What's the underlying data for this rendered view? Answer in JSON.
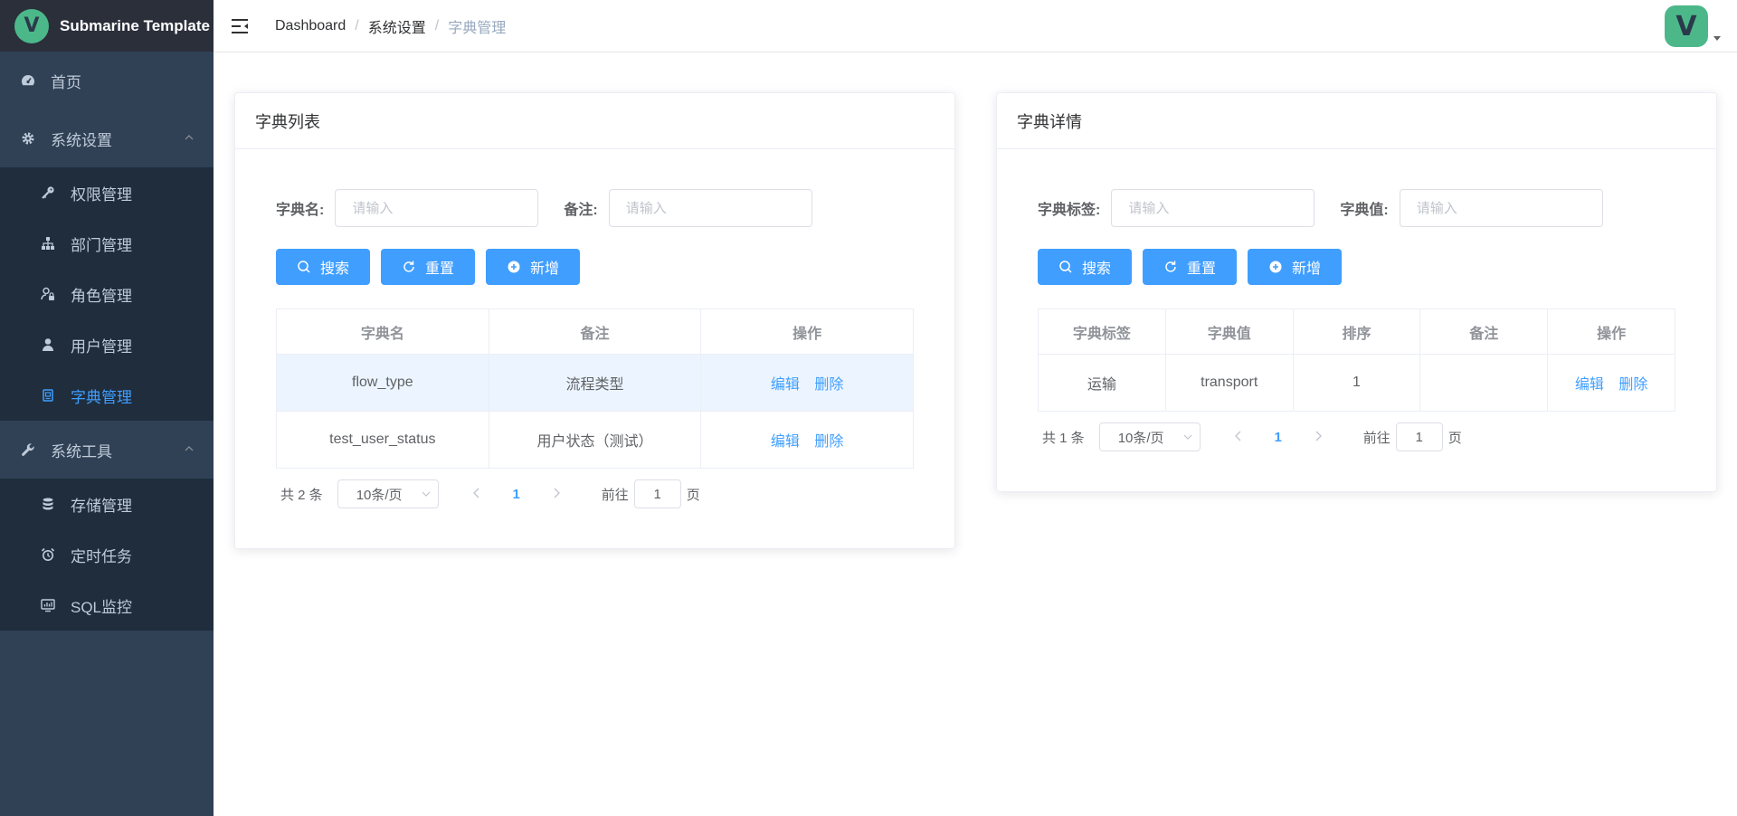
{
  "app": {
    "title": "Submarine Template",
    "logo_letter": "V"
  },
  "sidebar": {
    "items": [
      {
        "label": "首页",
        "icon": "dashboard-icon"
      },
      {
        "label": "系统设置",
        "icon": "gear-icon",
        "expanded": true,
        "children": [
          {
            "label": "权限管理",
            "icon": "key-icon"
          },
          {
            "label": "部门管理",
            "icon": "org-tree-icon"
          },
          {
            "label": "角色管理",
            "icon": "user-lock-icon"
          },
          {
            "label": "用户管理",
            "icon": "user-icon"
          },
          {
            "label": "字典管理",
            "icon": "dictionary-icon",
            "active": true
          }
        ]
      },
      {
        "label": "系统工具",
        "icon": "wrench-icon",
        "expanded": true,
        "children": [
          {
            "label": "存储管理",
            "icon": "database-icon"
          },
          {
            "label": "定时任务",
            "icon": "alarm-clock-icon"
          },
          {
            "label": "SQL监控",
            "icon": "monitor-icon"
          }
        ]
      }
    ]
  },
  "breadcrumb": [
    "Dashboard",
    "系统设置",
    "字典管理"
  ],
  "user": {
    "avatar_letter": "V"
  },
  "dict_list": {
    "title": "字典列表",
    "filters": {
      "name_label": "字典名:",
      "name_placeholder": "请输入",
      "remark_label": "备注:",
      "remark_placeholder": "请输入"
    },
    "buttons": {
      "search": "搜索",
      "reset": "重置",
      "add": "新增"
    },
    "columns": [
      "字典名",
      "备注",
      "操作"
    ],
    "rows": [
      {
        "name": "flow_type",
        "remark": "流程类型",
        "edit": "编辑",
        "delete": "删除"
      },
      {
        "name": "test_user_status",
        "remark": "用户状态（测试）",
        "edit": "编辑",
        "delete": "删除"
      }
    ],
    "pagination": {
      "total": "共 2 条",
      "page_size": "10条/页",
      "current": "1",
      "goto_label": "前往",
      "goto_value": "1",
      "goto_suffix": "页"
    }
  },
  "dict_detail": {
    "title": "字典详情",
    "filters": {
      "label_label": "字典标签:",
      "label_placeholder": "请输入",
      "value_label": "字典值:",
      "value_placeholder": "请输入"
    },
    "buttons": {
      "search": "搜索",
      "reset": "重置",
      "add": "新增"
    },
    "columns": [
      "字典标签",
      "字典值",
      "排序",
      "备注",
      "操作"
    ],
    "rows": [
      {
        "label": "运输",
        "value": "transport",
        "sort": "1",
        "remark": "",
        "edit": "编辑",
        "delete": "删除"
      }
    ],
    "pagination": {
      "total": "共 1 条",
      "page_size": "10条/页",
      "current": "1",
      "goto_label": "前往",
      "goto_value": "1",
      "goto_suffix": "页"
    }
  },
  "colors": {
    "primary": "#409eff",
    "sidebar_bg": "#304156",
    "submenu_bg": "#1f2d3d",
    "logo_bg": "#2b2f3a",
    "brand_green": "#4cb88a"
  }
}
